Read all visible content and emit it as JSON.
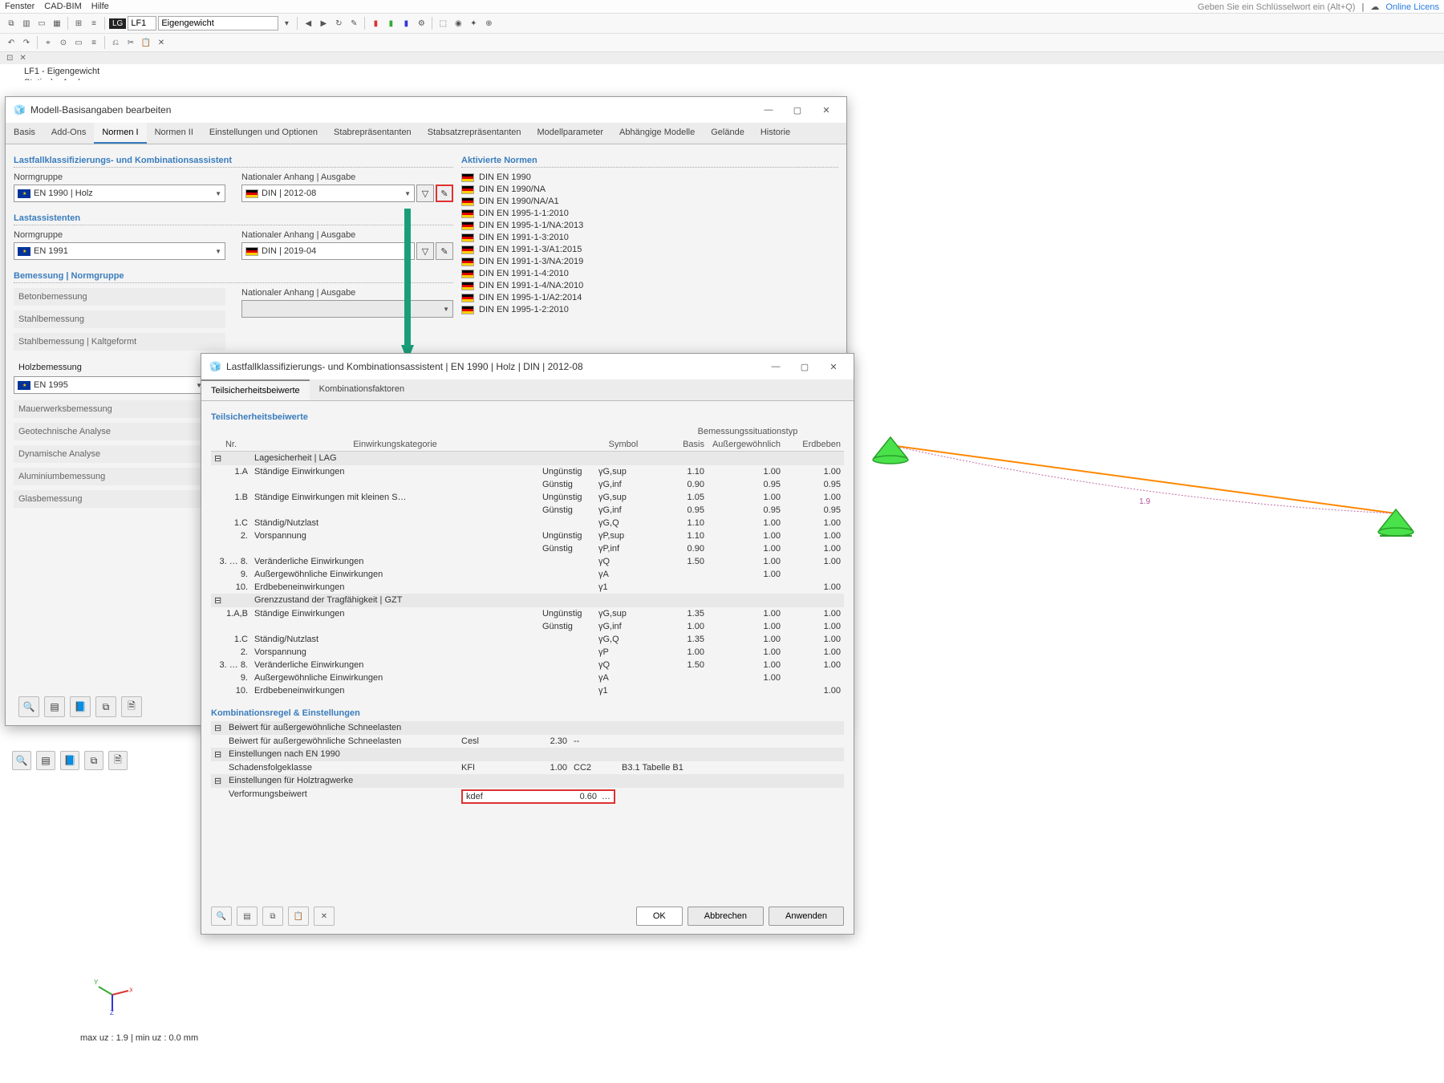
{
  "top_menu": {
    "fenster": "Fenster",
    "cadbim": "CAD-BIM",
    "hilfe": "Hilfe"
  },
  "top_right": {
    "search_placeholder": "Geben Sie ein Schlüsselwort ein (Alt+Q)",
    "online": "Online Licens"
  },
  "lf_combo": {
    "tag": "LG",
    "code": "LF1",
    "name": "Eigengewicht"
  },
  "tab": {
    "title": "LF1 - Eigengewicht",
    "sub": "Statische Analyse"
  },
  "dialog1": {
    "title": "Modell-Basisangaben bearbeiten",
    "tabs": [
      "Basis",
      "Add-Ons",
      "Normen I",
      "Normen II",
      "Einstellungen und Optionen",
      "Stabrepräsentanten",
      "Stabsatzrepräsentanten",
      "Modellparameter",
      "Abhängige Modelle",
      "Gelände",
      "Historie"
    ],
    "lastfall_hdr": "Lastfallklassifizierungs- und Kombinationsassistent",
    "normgruppe_lbl": "Normgruppe",
    "anhang_lbl": "Nationaler Anhang | Ausgabe",
    "en1990": "EN 1990 | Holz",
    "din2012": "DIN | 2012-08",
    "lastassist": "Lastassistenten",
    "en1991": "EN 1991",
    "din2019": "DIN | 2019-04",
    "bem_hdr": "Bemessung | Normgruppe",
    "items": [
      "Betonbemessung",
      "Stahlbemessung",
      "Stahlbemessung | Kaltgeformt"
    ],
    "holz_hdr": "Holzbemessung",
    "en1995": "EN 1995",
    "items2": [
      "Mauerwerksbemessung",
      "Geotechnische Analyse",
      "Dynamische Analyse",
      "Aluminiumbemessung",
      "Glasbemessung"
    ],
    "aktiv_hdr": "Aktivierte Normen",
    "norms": [
      "DIN EN 1990",
      "DIN EN 1990/NA",
      "DIN EN 1990/NA/A1",
      "DIN EN 1995-1-1:2010",
      "DIN EN 1995-1-1/NA:2013",
      "DIN EN 1991-1-3:2010",
      "DIN EN 1991-1-3/A1:2015",
      "DIN EN 1991-1-3/NA:2019",
      "DIN EN 1991-1-4:2010",
      "DIN EN 1991-1-4/NA:2010",
      "DIN EN 1995-1-1/A2:2014",
      "DIN EN 1995-1-2:2010"
    ]
  },
  "dialog2": {
    "title": "Lastfallklassifizierungs- und Kombinationsassistent | EN 1990 | Holz | DIN | 2012-08",
    "tab1": "Teilsicherheitsbeiwerte",
    "tab2": "Kombinationsfaktoren",
    "hdr1": "Teilsicherheitsbeiwerte",
    "cols": {
      "nr": "Nr.",
      "kat": "Einwirkungskategorie",
      "sym": "Symbol",
      "basis": "Basis",
      "aus": "Außergewöhnlich",
      "erd": "Erdbeben",
      "situ": "Bemessungssituationstyp"
    },
    "lag_hdr": "Lagesicherheit | LAG",
    "lag_rows": [
      {
        "nr": "1.A",
        "kat": "Ständige Einwirkungen",
        "c": "Ungünstig",
        "sym": "γG,sup",
        "b": "1.10",
        "a": "1.00",
        "e": "1.00"
      },
      {
        "c": "Günstig",
        "sym": "γG,inf",
        "b": "0.90",
        "a": "0.95",
        "e": "0.95"
      },
      {
        "nr": "1.B",
        "kat": "Ständige Einwirkungen mit kleinen S…",
        "c": "Ungünstig",
        "sym": "γG,sup",
        "b": "1.05",
        "a": "1.00",
        "e": "1.00"
      },
      {
        "c": "Günstig",
        "sym": "γG,inf",
        "b": "0.95",
        "a": "0.95",
        "e": "0.95"
      },
      {
        "nr": "1.C",
        "kat": "Ständig/Nutzlast",
        "sym": "γG,Q",
        "b": "1.10",
        "a": "1.00",
        "e": "1.00"
      },
      {
        "nr": "2.",
        "kat": "Vorspannung",
        "c": "Ungünstig",
        "sym": "γP,sup",
        "b": "1.10",
        "a": "1.00",
        "e": "1.00"
      },
      {
        "c": "Günstig",
        "sym": "γP,inf",
        "b": "0.90",
        "a": "1.00",
        "e": "1.00"
      },
      {
        "nr": "3. … 8.",
        "kat": "Veränderliche Einwirkungen",
        "sym": "γQ",
        "b": "1.50",
        "a": "1.00",
        "e": "1.00"
      },
      {
        "nr": "9.",
        "kat": "Außergewöhnliche Einwirkungen",
        "sym": "γA",
        "a": "1.00"
      },
      {
        "nr": "10.",
        "kat": "Erdbebeneinwirkungen",
        "sym": "γ1",
        "e": "1.00"
      }
    ],
    "gzt_hdr": "Grenzzustand der Tragfähigkeit | GZT",
    "gzt_rows": [
      {
        "nr": "1.A,B",
        "kat": "Ständige Einwirkungen",
        "c": "Ungünstig",
        "sym": "γG,sup",
        "b": "1.35",
        "a": "1.00",
        "e": "1.00"
      },
      {
        "c": "Günstig",
        "sym": "γG,inf",
        "b": "1.00",
        "a": "1.00",
        "e": "1.00"
      },
      {
        "nr": "1.C",
        "kat": "Ständig/Nutzlast",
        "sym": "γG,Q",
        "b": "1.35",
        "a": "1.00",
        "e": "1.00"
      },
      {
        "nr": "2.",
        "kat": "Vorspannung",
        "sym": "γP",
        "b": "1.00",
        "a": "1.00",
        "e": "1.00"
      },
      {
        "nr": "3. … 8.",
        "kat": "Veränderliche Einwirkungen",
        "sym": "γQ",
        "b": "1.50",
        "a": "1.00",
        "e": "1.00"
      },
      {
        "nr": "9.",
        "kat": "Außergewöhnliche Einwirkungen",
        "sym": "γA",
        "a": "1.00"
      },
      {
        "nr": "10.",
        "kat": "Erdbebeneinwirkungen",
        "sym": "γ1",
        "e": "1.00"
      }
    ],
    "komb_hdr": "Kombinationsregel & Einstellungen",
    "snow": {
      "grp": "Beiwert für außergewöhnliche Schneelasten",
      "row": "Beiwert für außergewöhnliche Schneelasten",
      "sym": "Cesl",
      "val": "2.30",
      "d": "--"
    },
    "en1990set": {
      "grp": "Einstellungen nach EN 1990",
      "row": "Schadensfolgeklasse",
      "sym": "KFI",
      "val": "1.00",
      "cc": "CC2",
      "ref": "B3.1 Tabelle B1"
    },
    "holz": {
      "grp": "Einstellungen für Holztragwerke",
      "row": "Verformungsbeiwert",
      "sym": "kdef",
      "val": "0.60",
      "d": "…"
    },
    "btns": {
      "ok": "OK",
      "cancel": "Abbrechen",
      "apply": "Anwenden"
    }
  },
  "viewport": {
    "dim": "1.9"
  },
  "status": "max uz : 1.9 | min uz : 0.0 mm"
}
